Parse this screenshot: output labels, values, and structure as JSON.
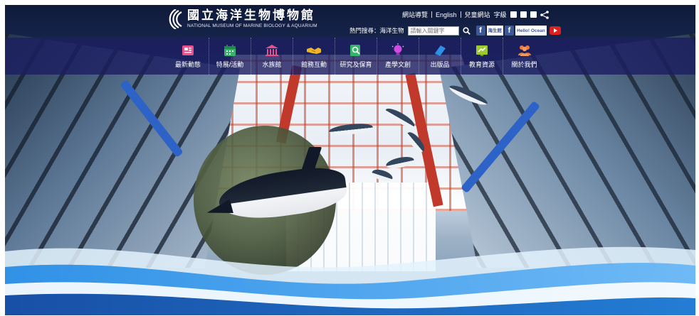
{
  "site": {
    "name_cn": "國立海洋生物博物館",
    "name_en": "NATIONAL MUSEUM OF MARINE BIOLOGY & AQUARIUM"
  },
  "utility_links": [
    {
      "label": "網站導覽"
    },
    {
      "label": "English"
    },
    {
      "label": "兒童網站"
    }
  ],
  "font_size": {
    "label": "字級",
    "options": [
      "small-font-icon",
      "medium-font-icon",
      "large-font-icon"
    ]
  },
  "search": {
    "hot_keywords_label": "熱門搜尋：海洋生物",
    "placeholder": "請輸入關鍵字"
  },
  "social": [
    {
      "icon": "facebook-icon",
      "label": "海生館"
    },
    {
      "icon": "facebook-icon",
      "label": "Hello! Ocean"
    },
    {
      "icon": "youtube-icon",
      "label": ""
    }
  ],
  "nav": [
    {
      "label": "最新動態",
      "icon": "news-icon",
      "color": "#e8508a"
    },
    {
      "label": "特展/活動",
      "icon": "calendar-icon",
      "color": "#34b46a"
    },
    {
      "label": "水族館",
      "icon": "museum-icon",
      "color": "#e8508a"
    },
    {
      "label": "館務互動",
      "icon": "handshake-icon",
      "color": "#f0b429"
    },
    {
      "label": "研究及保育",
      "icon": "research-icon",
      "color": "#34b46a"
    },
    {
      "label": "產學文創",
      "icon": "lightbulb-icon",
      "color": "#d04ce0"
    },
    {
      "label": "出版品",
      "icon": "book-icon",
      "color": "#2f8ee6"
    },
    {
      "label": "教育資源",
      "icon": "education-icon",
      "color": "#9cc931"
    },
    {
      "label": "關於我們",
      "icon": "people-icon",
      "color": "#f07a3a"
    }
  ],
  "colors": {
    "nav_bg": "#1c1e60",
    "accent_red": "#c0392b",
    "wave_blue": "#1e88e5"
  }
}
